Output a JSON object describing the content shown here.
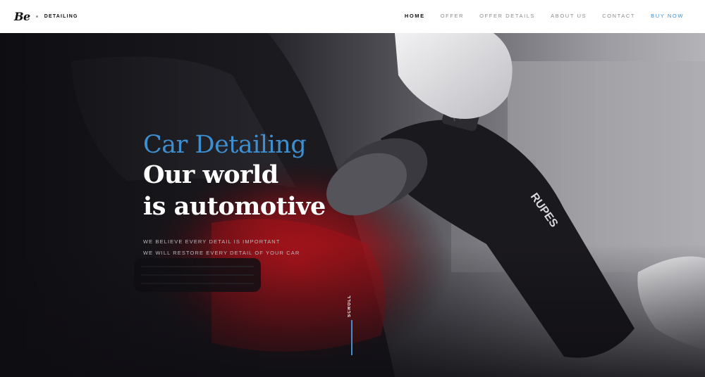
{
  "brand": {
    "mark": "Be",
    "name": "DETAILING"
  },
  "nav": [
    {
      "label": "HOME",
      "state": "active"
    },
    {
      "label": "OFFER",
      "state": ""
    },
    {
      "label": "OFFER DETAILS",
      "state": ""
    },
    {
      "label": "ABOUT US",
      "state": ""
    },
    {
      "label": "CONTACT",
      "state": ""
    },
    {
      "label": "BUY NOW",
      "state": "highlight"
    }
  ],
  "hero": {
    "accent": "Car Detailing",
    "line1": "Our world",
    "line2": "is automotive",
    "sub1": "WE BELIEVE EVERY DETAIL IS IMPORTANT",
    "sub2": "WE WILL RESTORE EVERY DETAIL OF YOUR CAR",
    "scroll": "SCROLL",
    "polisher_brand": "RUPES"
  },
  "colors": {
    "accent": "#3d8fd0",
    "header_bg": "#ffffff",
    "hero_bg": "#15141a",
    "car_red": "#b3151c"
  }
}
